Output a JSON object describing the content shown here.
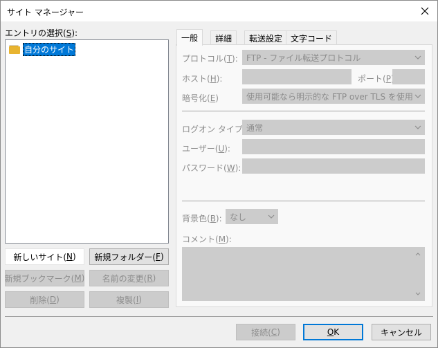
{
  "window": {
    "title": "サイト マネージャー"
  },
  "left": {
    "entry_label": "エントリの選択(",
    "entry_key": "S",
    "entry_tail": "):",
    "tree": [
      {
        "label": "自分のサイト",
        "icon": "folder-icon",
        "selected": true
      }
    ],
    "buttons": {
      "new_site": {
        "pre": "新しいサイト(",
        "key": "N",
        "post": ")"
      },
      "new_folder": {
        "pre": "新規フォルダー(",
        "key": "F",
        "post": ")"
      },
      "new_bookmark": {
        "pre": "新規ブックマーク(",
        "key": "M",
        "post": ")"
      },
      "rename": {
        "pre": "名前の変更(",
        "key": "R",
        "post": ")"
      },
      "delete": {
        "pre": "削除(",
        "key": "D",
        "post": ")"
      },
      "duplicate": {
        "pre": "複製(",
        "key": "I",
        "post": ")"
      }
    }
  },
  "tabs": [
    {
      "label": "一般"
    },
    {
      "label": "詳細"
    },
    {
      "label": "転送設定"
    },
    {
      "label": "文字コード"
    }
  ],
  "general": {
    "protocol": {
      "pre": "プロトコル(",
      "key": "T",
      "post": "):",
      "value": "FTP - ファイル転送プロトコル"
    },
    "host": {
      "pre": "ホスト(",
      "key": "H",
      "post": "):",
      "value": ""
    },
    "port": {
      "pre": "ポート(",
      "key": "P",
      "post": "):",
      "value": ""
    },
    "encryption": {
      "pre": "暗号化(",
      "key": "E",
      "post": ")",
      "value": "使用可能なら明示的な FTP over TLS を使用"
    },
    "logon_type": {
      "pre": "ログオン タイプ(",
      "key": "L",
      "post": "):",
      "value": "通常"
    },
    "user": {
      "pre": "ユーザー(",
      "key": "U",
      "post": "):",
      "value": ""
    },
    "password": {
      "pre": "パスワード(",
      "key": "W",
      "post": "):",
      "value": ""
    },
    "background": {
      "pre": "背景色(",
      "key": "B",
      "post": "):",
      "value": "なし"
    },
    "comment": {
      "pre": "コメント(",
      "key": "M",
      "post": "):",
      "value": ""
    }
  },
  "footer": {
    "connect": {
      "pre": "接続(",
      "key": "C",
      "post": ")"
    },
    "ok": {
      "key": "O",
      "post": "K"
    },
    "cancel": {
      "label": "キャンセル"
    }
  }
}
